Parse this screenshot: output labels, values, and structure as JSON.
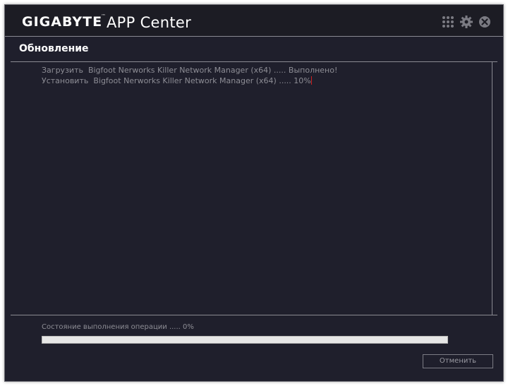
{
  "titlebar": {
    "brand": "GIGABYTE",
    "trademark": "™",
    "app_name": "APP Center",
    "icons": [
      "grid-icon",
      "gear-icon",
      "close-icon"
    ]
  },
  "section": {
    "title": "Обновление"
  },
  "log": {
    "lines": [
      "Загрузить  Bigfoot Nerworks Killer Network Manager (x64) ..... Выполнено!",
      "Установить  Bigfoot Nerworks Killer Network Manager (x64) ..... 10%"
    ]
  },
  "status": {
    "text": "Состояние выполнения операции ..... 0%",
    "progress_percent": 0
  },
  "buttons": {
    "cancel": "Отменить"
  },
  "colors": {
    "window_bg": "#1f1f2c",
    "titlebar_bg": "#1c1c24",
    "log_text": "#8d8d95",
    "caret": "#d02020"
  }
}
